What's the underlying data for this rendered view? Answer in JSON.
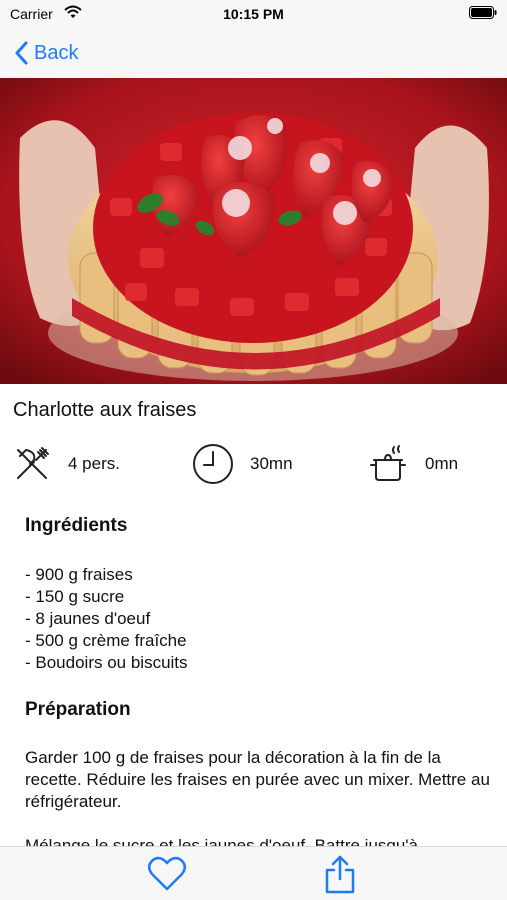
{
  "status_bar": {
    "carrier": "Carrier",
    "time": "10:15 PM"
  },
  "nav": {
    "back_label": "Back",
    "tint_color": "#1e7cf2"
  },
  "hero_image": {
    "subject": "strawberry charlotte cake held in hands"
  },
  "recipe": {
    "title": "Charlotte aux fraises",
    "servings": "4 pers.",
    "prep_time": "30mn",
    "cook_time": "0mn"
  },
  "ingredients": {
    "heading": "Ingrédients",
    "items": [
      "- 900 g fraises",
      "- 150 g sucre",
      "- 8 jaunes d'oeuf",
      "- 500 g crème fraîche",
      "- Boudoirs ou biscuits"
    ]
  },
  "preparation": {
    "heading": "Préparation",
    "paragraphs": [
      "Garder 100 g de fraises pour la décoration à la fin de la recette. Réduire les fraises en purée avec un mixer. Mettre au réfrigérateur.",
      "Mélange le sucre et les jaunes d'oeuf. Battre jusqu'à"
    ]
  },
  "tab_bar": {
    "icons": [
      "heart-icon",
      "share-icon"
    ]
  }
}
